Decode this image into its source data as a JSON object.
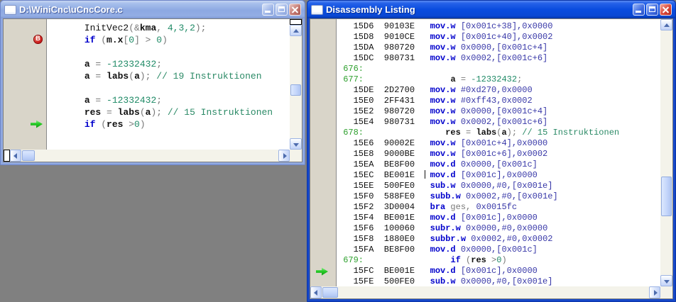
{
  "colors": {
    "desktop_bg": "#808080",
    "active_title_blue": "#0A4CDE",
    "inactive_title_blue": "#8CA8E2",
    "keyword_blue": "#0000CC",
    "number_comment_teal": "#1F8A66",
    "operand_navy": "#3838A8",
    "line_number_green": "#2FA02F",
    "breakpoint_red": "#C41212",
    "current_line_arrow_green": "#28CC28",
    "gutter_beige": "#D9D5C9"
  },
  "editor_window": {
    "title": "D:\\WiniCnc\\uCncCore.c",
    "markers": [
      {
        "line": 1,
        "type": "breakpoint",
        "label": "B"
      },
      {
        "line": 8,
        "type": "arrow"
      }
    ],
    "lines": [
      [
        {
          "c": "p",
          "t": "      InitVec2"
        },
        {
          "c": "g",
          "t": "("
        },
        {
          "c": "g",
          "t": "&"
        },
        {
          "c": "i",
          "t": "kma"
        },
        {
          "c": "g",
          "t": ", "
        },
        {
          "c": "n",
          "t": "4,3,2"
        },
        {
          "c": "g",
          "t": ");"
        }
      ],
      [
        {
          "c": "p",
          "t": "      "
        },
        {
          "c": "k",
          "t": "if"
        },
        {
          "c": "g",
          "t": " ("
        },
        {
          "c": "i",
          "t": "m.x"
        },
        {
          "c": "g",
          "t": "["
        },
        {
          "c": "n",
          "t": "0"
        },
        {
          "c": "g",
          "t": "] > "
        },
        {
          "c": "n",
          "t": "0"
        },
        {
          "c": "g",
          "t": ")"
        }
      ],
      [],
      [
        {
          "c": "p",
          "t": "      "
        },
        {
          "c": "i",
          "t": "a"
        },
        {
          "c": "g",
          "t": " = "
        },
        {
          "c": "n",
          "t": "-12332432"
        },
        {
          "c": "g",
          "t": ";"
        }
      ],
      [
        {
          "c": "p",
          "t": "      "
        },
        {
          "c": "i",
          "t": "a"
        },
        {
          "c": "g",
          "t": " = "
        },
        {
          "c": "i",
          "t": "labs"
        },
        {
          "c": "g",
          "t": "("
        },
        {
          "c": "i",
          "t": "a"
        },
        {
          "c": "g",
          "t": "); "
        },
        {
          "c": "c",
          "t": "// 19 Instruktionen"
        }
      ],
      [],
      [
        {
          "c": "p",
          "t": "      "
        },
        {
          "c": "i",
          "t": "a"
        },
        {
          "c": "g",
          "t": " = "
        },
        {
          "c": "n",
          "t": "-12332432"
        },
        {
          "c": "g",
          "t": ";"
        }
      ],
      [
        {
          "c": "p",
          "t": "      "
        },
        {
          "c": "i",
          "t": "res"
        },
        {
          "c": "g",
          "t": " = "
        },
        {
          "c": "i",
          "t": "labs"
        },
        {
          "c": "g",
          "t": "("
        },
        {
          "c": "i",
          "t": "a"
        },
        {
          "c": "g",
          "t": "); "
        },
        {
          "c": "c",
          "t": "// 15 Instruktionen"
        }
      ],
      [
        {
          "c": "p",
          "t": "      "
        },
        {
          "c": "k",
          "t": "if"
        },
        {
          "c": "g",
          "t": " ("
        },
        {
          "c": "i",
          "t": "res"
        },
        {
          "c": "g",
          "t": " >"
        },
        {
          "c": "n",
          "t": "0"
        },
        {
          "c": "g",
          "t": ")"
        }
      ]
    ]
  },
  "disasm_window": {
    "title": "Disassembly Listing",
    "markers": [
      {
        "line": 23,
        "type": "arrow"
      }
    ],
    "lines": [
      [
        {
          "c": "p",
          "t": "   15D6  90103E   "
        },
        {
          "c": "k",
          "t": "mov.w"
        },
        {
          "c": "o",
          "t": " [0x001c+38],0x0000"
        }
      ],
      [
        {
          "c": "p",
          "t": "   15D8  9010CE   "
        },
        {
          "c": "k",
          "t": "mov.w"
        },
        {
          "c": "o",
          "t": " [0x001c+40],0x0002"
        }
      ],
      [
        {
          "c": "p",
          "t": "   15DA  980720   "
        },
        {
          "c": "k",
          "t": "mov.w"
        },
        {
          "c": "o",
          "t": " 0x0000,[0x001c+4]"
        }
      ],
      [
        {
          "c": "p",
          "t": "   15DC  980731   "
        },
        {
          "c": "k",
          "t": "mov.w"
        },
        {
          "c": "o",
          "t": " 0x0002,[0x001c+6]"
        }
      ],
      [
        {
          "c": "ln",
          "t": " 676:"
        }
      ],
      [
        {
          "c": "ln",
          "t": " 677:"
        },
        {
          "c": "p",
          "t": "                 "
        },
        {
          "c": "i",
          "t": "a"
        },
        {
          "c": "g",
          "t": " = "
        },
        {
          "c": "n",
          "t": "-12332432"
        },
        {
          "c": "g",
          "t": ";"
        }
      ],
      [
        {
          "c": "p",
          "t": "   15DE  2D2700   "
        },
        {
          "c": "k",
          "t": "mov.w"
        },
        {
          "c": "o",
          "t": " #0xd270,0x0000"
        }
      ],
      [
        {
          "c": "p",
          "t": "   15E0  2FF431   "
        },
        {
          "c": "k",
          "t": "mov.w"
        },
        {
          "c": "o",
          "t": " #0xff43,0x0002"
        }
      ],
      [
        {
          "c": "p",
          "t": "   15E2  980720   "
        },
        {
          "c": "k",
          "t": "mov.w"
        },
        {
          "c": "o",
          "t": " 0x0000,[0x001c+4]"
        }
      ],
      [
        {
          "c": "p",
          "t": "   15E4  980731   "
        },
        {
          "c": "k",
          "t": "mov.w"
        },
        {
          "c": "o",
          "t": " 0x0002,[0x001c+6]"
        }
      ],
      [
        {
          "c": "ln",
          "t": " 678:"
        },
        {
          "c": "p",
          "t": "                "
        },
        {
          "c": "i",
          "t": "res"
        },
        {
          "c": "g",
          "t": " = "
        },
        {
          "c": "i",
          "t": "labs"
        },
        {
          "c": "g",
          "t": "("
        },
        {
          "c": "i",
          "t": "a"
        },
        {
          "c": "g",
          "t": "); "
        },
        {
          "c": "c",
          "t": "// 15 Instruktionen"
        }
      ],
      [
        {
          "c": "p",
          "t": "   15E6  90002E   "
        },
        {
          "c": "k",
          "t": "mov.w"
        },
        {
          "c": "o",
          "t": " [0x001c+4],0x0000"
        }
      ],
      [
        {
          "c": "p",
          "t": "   15E8  9000BE   "
        },
        {
          "c": "k",
          "t": "mov.w"
        },
        {
          "c": "o",
          "t": " [0x001c+6],0x0002"
        }
      ],
      [
        {
          "c": "p",
          "t": "   15EA  BE8F00   "
        },
        {
          "c": "k",
          "t": "mov.d"
        },
        {
          "c": "o",
          "t": " 0x0000,[0x001c]"
        }
      ],
      [
        {
          "c": "p",
          "t": "   15EC  BE001E  "
        },
        {
          "c": "crt",
          "t": ""
        },
        {
          "c": "p",
          "t": " "
        },
        {
          "c": "k",
          "t": "mov.d"
        },
        {
          "c": "o",
          "t": " [0x001c],0x0000"
        }
      ],
      [
        {
          "c": "p",
          "t": "   15EE  500FE0   "
        },
        {
          "c": "k",
          "t": "sub.w"
        },
        {
          "c": "o",
          "t": " 0x0000,#0,[0x001e]"
        }
      ],
      [
        {
          "c": "p",
          "t": "   15F0  588FE0   "
        },
        {
          "c": "k",
          "t": "subb.w"
        },
        {
          "c": "o",
          "t": " 0x0002,#0,[0x001e]"
        }
      ],
      [
        {
          "c": "p",
          "t": "   15F2  3D0004   "
        },
        {
          "c": "k",
          "t": "bra"
        },
        {
          "c": "g",
          "t": " ges, "
        },
        {
          "c": "o",
          "t": "0x0015fc"
        }
      ],
      [
        {
          "c": "p",
          "t": "   15F4  BE001E   "
        },
        {
          "c": "k",
          "t": "mov.d"
        },
        {
          "c": "o",
          "t": " [0x001c],0x0000"
        }
      ],
      [
        {
          "c": "p",
          "t": "   15F6  100060   "
        },
        {
          "c": "k",
          "t": "subr.w"
        },
        {
          "c": "o",
          "t": " 0x0000,#0,0x0000"
        }
      ],
      [
        {
          "c": "p",
          "t": "   15F8  1880E0   "
        },
        {
          "c": "k",
          "t": "subbr.w"
        },
        {
          "c": "o",
          "t": " 0x0002,#0,0x0002"
        }
      ],
      [
        {
          "c": "p",
          "t": "   15FA  BE8F00   "
        },
        {
          "c": "k",
          "t": "mov.d"
        },
        {
          "c": "o",
          "t": " 0x0000,[0x001c]"
        }
      ],
      [
        {
          "c": "ln",
          "t": " 679:"
        },
        {
          "c": "p",
          "t": "                 "
        },
        {
          "c": "k",
          "t": "if"
        },
        {
          "c": "g",
          "t": " ("
        },
        {
          "c": "i",
          "t": "res"
        },
        {
          "c": "g",
          "t": " >"
        },
        {
          "c": "n",
          "t": "0"
        },
        {
          "c": "g",
          "t": ")"
        }
      ],
      [
        {
          "c": "p",
          "t": "   15FC  BE001E   "
        },
        {
          "c": "k",
          "t": "mov.d"
        },
        {
          "c": "o",
          "t": " [0x001c],0x0000"
        }
      ],
      [
        {
          "c": "p",
          "t": "   15FE  500FE0   "
        },
        {
          "c": "k",
          "t": "sub.w"
        },
        {
          "c": "o",
          "t": " 0x0000,#0,[0x001e]"
        }
      ]
    ]
  }
}
